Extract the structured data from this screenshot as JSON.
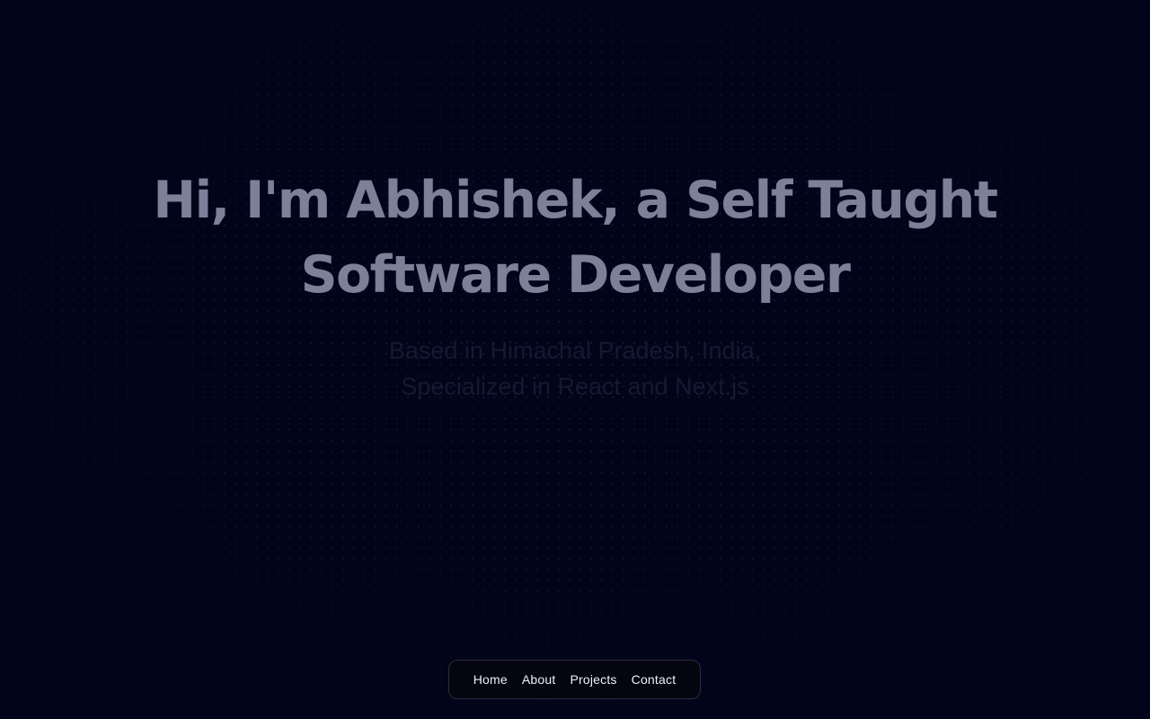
{
  "hero": {
    "title_line1": "Hi, I'm Abhishek, a Self Taught",
    "title_line2": "Software Developer",
    "subtitle_line1": "Based in Himachal Pradesh, India,",
    "subtitle_line2": "Specialized in React and Next.js"
  },
  "nav": {
    "items": [
      {
        "label": "Home"
      },
      {
        "label": "About"
      },
      {
        "label": "Projects"
      },
      {
        "label": "Contact"
      }
    ]
  },
  "colors": {
    "background": "#02041a",
    "title": "#7c8098",
    "subtitle": "#16192f",
    "nav_background": "#05050f",
    "nav_text": "#eef0f6"
  }
}
